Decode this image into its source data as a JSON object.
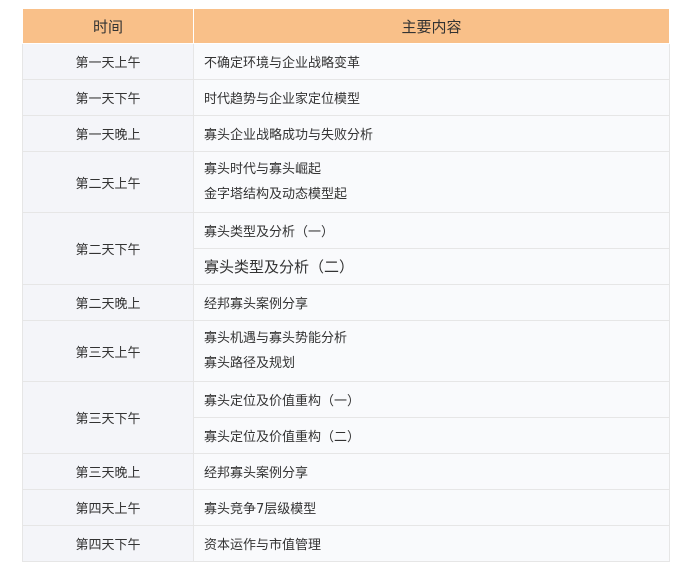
{
  "table": {
    "header": {
      "time": "时间",
      "content": "主要内容"
    },
    "rows": [
      {
        "time": "第一天上午",
        "content": [
          "不确定环境与企业战略变革"
        ]
      },
      {
        "time": "第一天下午",
        "content": [
          "时代趋势与企业家定位模型"
        ]
      },
      {
        "time": "第一天晚上",
        "content": [
          "寡头企业战略成功与失败分析"
        ]
      },
      {
        "time": "第二天上午",
        "content": [
          "寡头时代与寡头崛起",
          "金字塔结构及动态模型起"
        ]
      },
      {
        "time": "第二天下午",
        "content": [
          "寡头类型及分析（一）",
          "寡头类型及分析（二）"
        ]
      },
      {
        "time": "第二天晚上",
        "content": [
          "经邦寡头案例分享"
        ]
      },
      {
        "time": "第三天上午",
        "content": [
          "寡头机遇与寡头势能分析",
          "寡头路径及规划"
        ]
      },
      {
        "time": "第三天下午",
        "content": [
          "寡头定位及价值重构（一）",
          "寡头定位及价值重构（二）"
        ]
      },
      {
        "time": "第三天晚上",
        "content": [
          "经邦寡头案例分享"
        ]
      },
      {
        "time": "第四天上午",
        "content": [
          "寡头竞争7层级模型"
        ]
      },
      {
        "time": "第四天下午",
        "content": [
          "资本运作与市值管理"
        ]
      }
    ]
  }
}
